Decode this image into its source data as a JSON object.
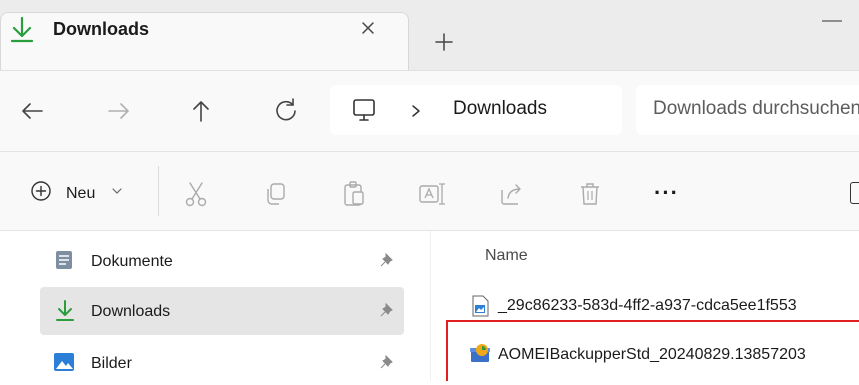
{
  "tab": {
    "title": "Downloads",
    "icon": "download-icon"
  },
  "toolbar": {
    "back_icon": "arrow-left-icon",
    "forward_icon": "arrow-right-icon",
    "up_icon": "arrow-up-icon",
    "refresh_icon": "refresh-icon"
  },
  "breadcrumb": {
    "location": "Downloads"
  },
  "search": {
    "placeholder": "Downloads durchsuchen"
  },
  "commands": {
    "new_label": "Neu",
    "more_label": "···"
  },
  "sidebar": {
    "items": [
      {
        "label": "Dokumente",
        "icon": "documents-icon",
        "pinned": true,
        "selected": false
      },
      {
        "label": "Downloads",
        "icon": "download-icon",
        "pinned": true,
        "selected": true
      },
      {
        "label": "Bilder",
        "icon": "pictures-icon",
        "pinned": true,
        "selected": false
      }
    ]
  },
  "file_list": {
    "column_name": "Name",
    "files": [
      {
        "name": "_29c86233-583d-4ff2-a937-cdca5ee1f553",
        "icon": "image-file-icon"
      },
      {
        "name": "AOMEIBackupperStd_20240829.13857203",
        "icon": "installer-icon",
        "highlighted": true
      }
    ]
  },
  "colors": {
    "accent": "#2a9d3c",
    "highlight": "#e01f1f",
    "selected_bg": "#e5e5e5"
  }
}
